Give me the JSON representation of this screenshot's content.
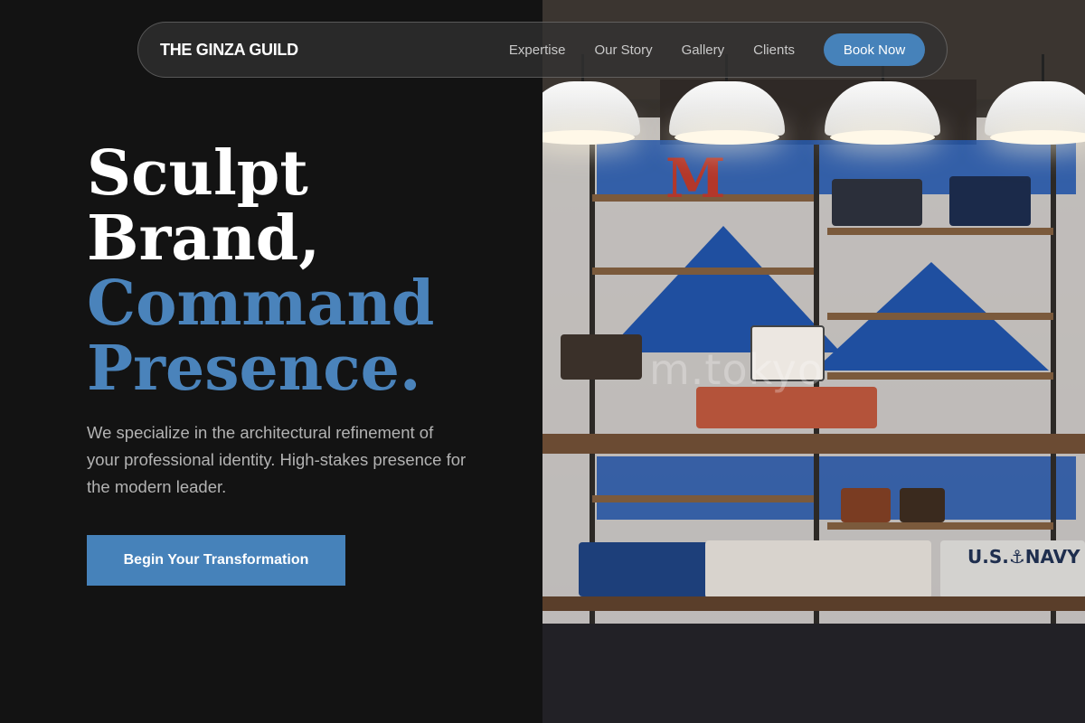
{
  "nav": {
    "brand": "THE GINZA GUILD",
    "links": [
      "Expertise",
      "Our Story",
      "Gallery",
      "Clients"
    ],
    "cta": "Book Now"
  },
  "hero": {
    "title_lines": [
      "Sculpt",
      "Brand,",
      "Command",
      "Presence."
    ],
    "subtitle": "We specialize in the architectural refinement of your professional identity. High-stakes presence for the modern leader.",
    "cta": "Begin Your Transformation"
  },
  "image": {
    "sign_letter": "M",
    "watermark": "m.tokyo",
    "shirt_print": "U.S.⚓NAVY"
  },
  "colors": {
    "accent": "#4682ba",
    "title_blue": "#4a83bb",
    "background": "#131313"
  }
}
